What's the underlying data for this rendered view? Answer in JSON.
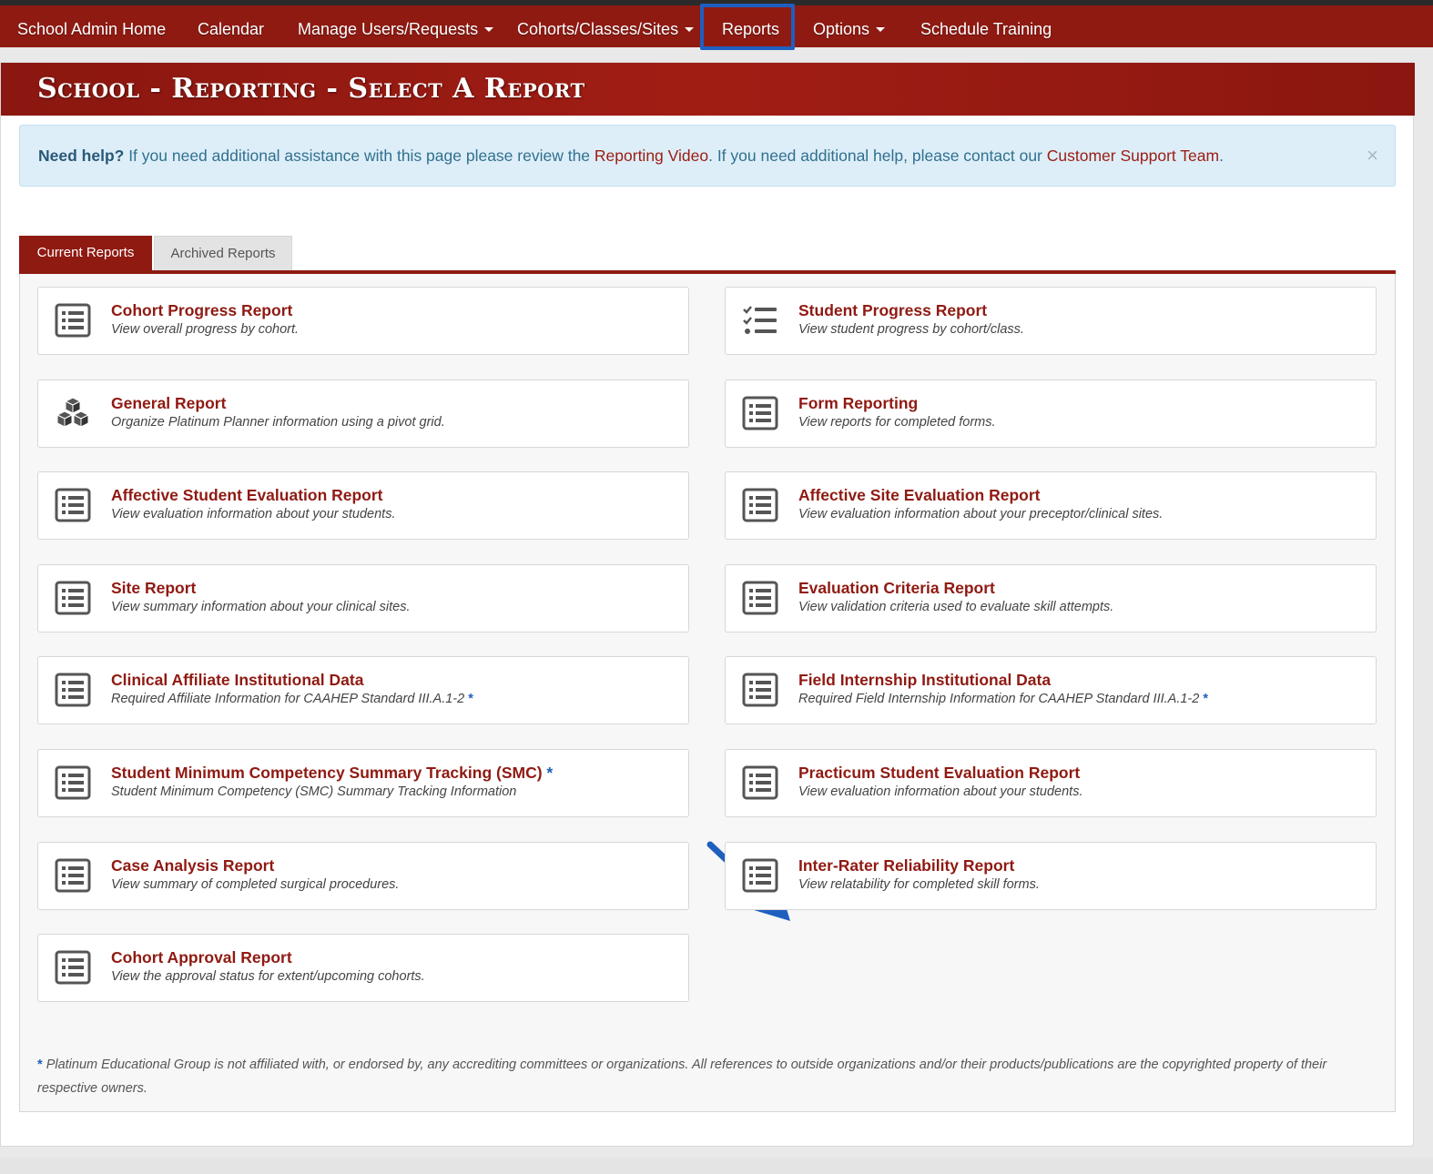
{
  "nav": {
    "items": [
      {
        "label": "School Admin Home",
        "dropdown": false
      },
      {
        "label": "Calendar",
        "dropdown": false
      },
      {
        "label": "Manage Users/Requests",
        "dropdown": true
      },
      {
        "label": "Cohorts/Classes/Sites",
        "dropdown": true
      },
      {
        "label": "Reports",
        "dropdown": false,
        "highlighted": true
      },
      {
        "label": "Options",
        "dropdown": true
      },
      {
        "label": "Schedule Training",
        "dropdown": false
      }
    ]
  },
  "header": {
    "title": "School - Reporting - Select A Report"
  },
  "alert": {
    "lead": "Need help?",
    "text1": " If you need additional assistance with this page please review the ",
    "link1": "Reporting Video",
    "text2": ". If you need additional help, please contact our ",
    "link2": "Customer Support Team",
    "text3": ".",
    "close": "×"
  },
  "tabs": {
    "current": "Current Reports",
    "archived": "Archived Reports"
  },
  "reports": [
    {
      "title": "Cohort Progress Report",
      "desc": "View overall progress by cohort.",
      "icon": "list-icon",
      "star_title": false,
      "star_desc": false
    },
    {
      "title": "Student Progress Report",
      "desc": "View student progress by cohort/class.",
      "icon": "checklist-icon",
      "star_title": false,
      "star_desc": false
    },
    {
      "title": "General Report",
      "desc": "Organize Platinum Planner information using a pivot grid.",
      "icon": "cubes-icon",
      "star_title": false,
      "star_desc": false
    },
    {
      "title": "Form Reporting",
      "desc": "View reports for completed forms.",
      "icon": "list-icon",
      "star_title": false,
      "star_desc": false
    },
    {
      "title": "Affective Student Evaluation Report",
      "desc": "View evaluation information about your students.",
      "icon": "list-icon",
      "star_title": false,
      "star_desc": false
    },
    {
      "title": "Affective Site Evaluation Report",
      "desc": "View evaluation information about your preceptor/clinical sites.",
      "icon": "list-icon",
      "star_title": false,
      "star_desc": false
    },
    {
      "title": "Site Report",
      "desc": "View summary information about your clinical sites.",
      "icon": "list-icon",
      "star_title": false,
      "star_desc": false
    },
    {
      "title": "Evaluation Criteria Report",
      "desc": "View validation criteria used to evaluate skill attempts.",
      "icon": "list-icon",
      "star_title": false,
      "star_desc": false
    },
    {
      "title": "Clinical Affiliate Institutional Data",
      "desc": "Required Affiliate Information for CAAHEP Standard III.A.1-2",
      "icon": "list-icon",
      "star_title": false,
      "star_desc": true
    },
    {
      "title": "Field Internship Institutional Data",
      "desc": "Required Field Internship Information for CAAHEP Standard III.A.1-2",
      "icon": "list-icon",
      "star_title": false,
      "star_desc": true
    },
    {
      "title": "Student Minimum Competency Summary Tracking (SMC)",
      "desc": "Student Minimum Competency (SMC) Summary Tracking Information",
      "icon": "list-icon",
      "star_title": true,
      "star_desc": false
    },
    {
      "title": "Practicum Student Evaluation Report",
      "desc": "View evaluation information about your students.",
      "icon": "list-icon",
      "star_title": false,
      "star_desc": false
    },
    {
      "title": "Case Analysis Report",
      "desc": "View summary of completed surgical procedures.",
      "icon": "list-icon",
      "star_title": false,
      "star_desc": false
    },
    {
      "title": "Inter-Rater Reliability Report",
      "desc": "View relatability for completed skill forms.",
      "icon": "list-icon",
      "star_title": false,
      "star_desc": false
    },
    {
      "title": "Cohort Approval Report",
      "desc": "View the approval status for extent/upcoming cohorts.",
      "icon": "list-icon",
      "star_title": false,
      "star_desc": false
    }
  ],
  "star": "*",
  "footnote": "Platinum Educational Group is not affiliated with, or endorsed by, any accrediting committees or organizations. All references to outside organizations and/or their products/publications are the copyrighted property of their respective owners.",
  "colors": {
    "brand": "#8f1a12",
    "highlight": "#1f5fbf",
    "alert_bg": "#ddeef8"
  }
}
